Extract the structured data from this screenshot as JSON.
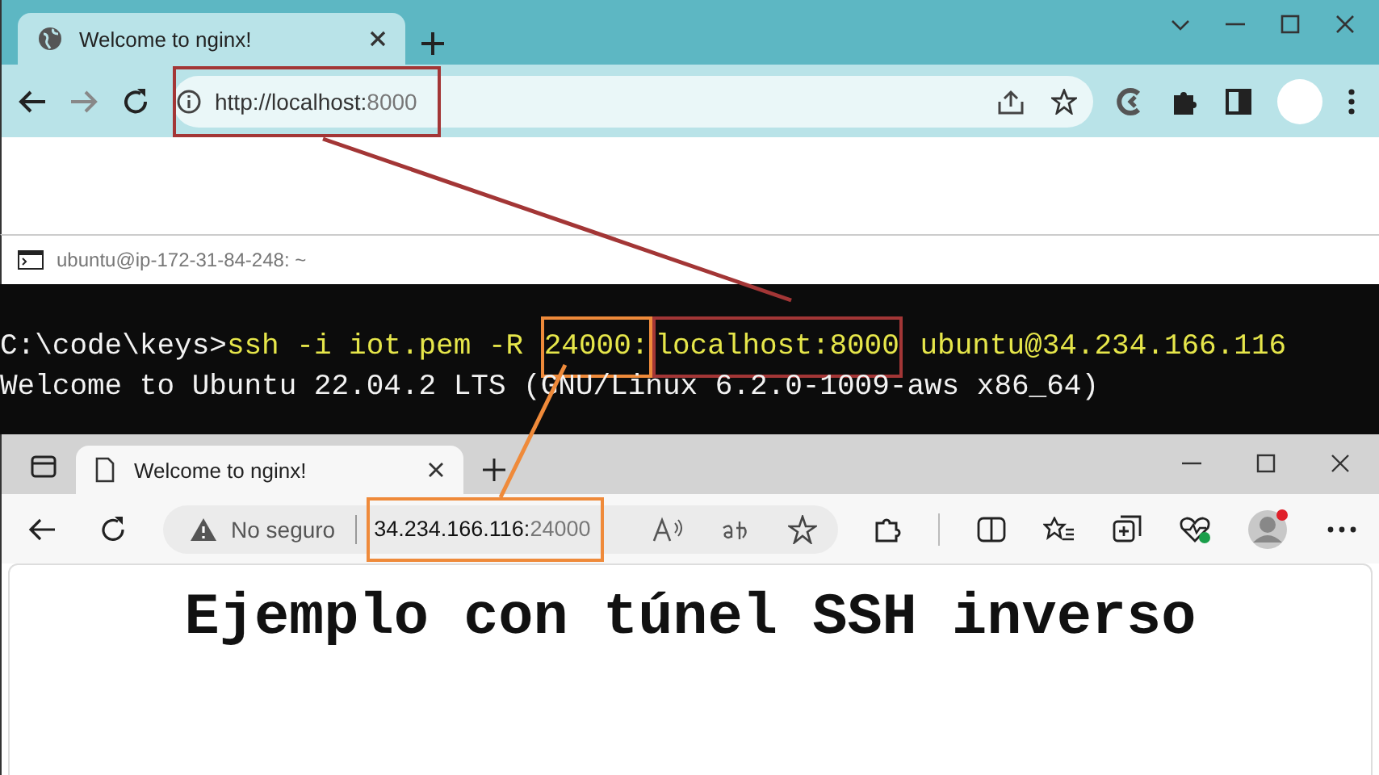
{
  "chrome": {
    "tab_title": "Welcome to nginx!",
    "url_host": "http://localhost:",
    "url_port": "8000",
    "highlight": {
      "color": "#a33636"
    }
  },
  "terminal": {
    "title": "ubuntu@ip-172-31-84-248: ~",
    "lines": [
      {
        "kind": "command",
        "prompt": "C:\\code\\keys>",
        "segments": [
          {
            "text": "ssh -i iot.pem -R"
          },
          {
            "text": "24000:",
            "highlight": {
              "color": "#ef8a3a"
            }
          },
          {
            "text": "localhost:8000",
            "highlight": {
              "color": "#a33636"
            }
          },
          {
            "text": "ubuntu@34.234.166.116"
          }
        ]
      },
      {
        "kind": "output",
        "text": "Welcome to Ubuntu 22.04.2 LTS (GNU/Linux 6.2.0-1009-aws x86_64)"
      }
    ]
  },
  "edge": {
    "tab_title": "Welcome to nginx!",
    "security": "No seguro",
    "url_host": "34.234.166.116:",
    "url_port": "24000",
    "highlight": {
      "color": "#ef8a3a"
    }
  },
  "page": {
    "heading": "Ejemplo con túnel SSH inverso"
  },
  "connectors": [
    {
      "color": "#a33636"
    },
    {
      "color": "#ef8a3a"
    }
  ]
}
